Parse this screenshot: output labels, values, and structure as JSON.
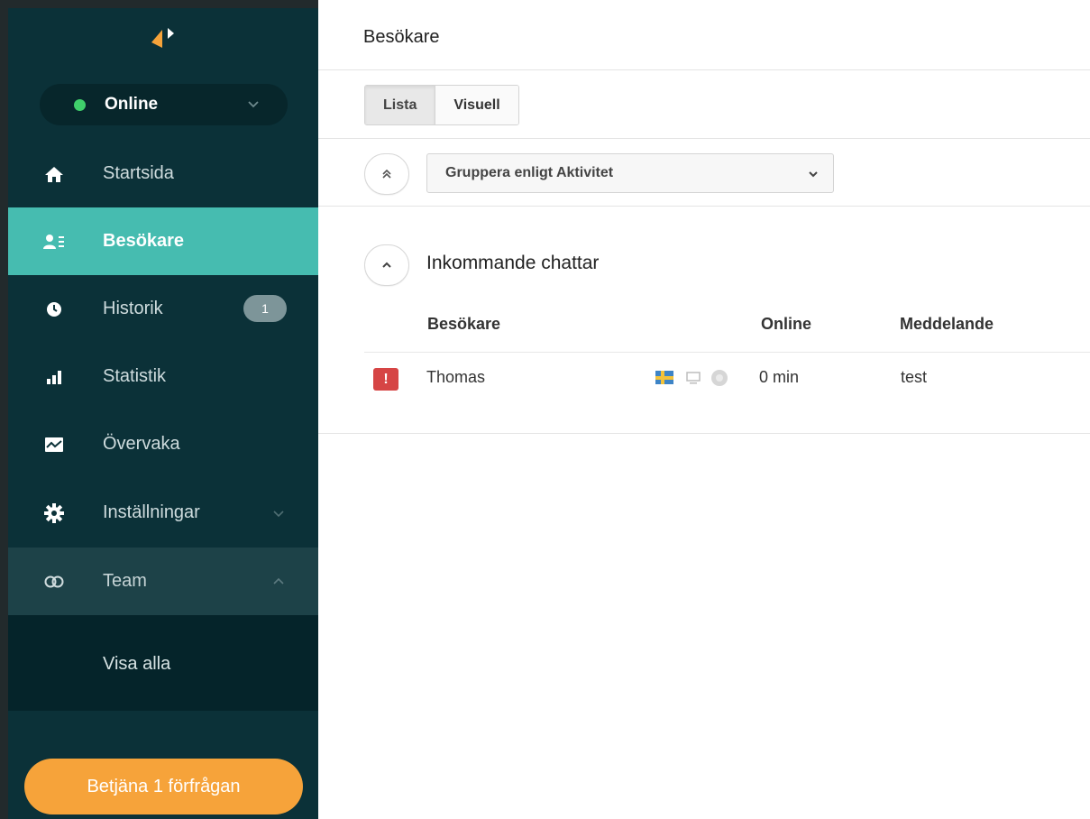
{
  "sidebar": {
    "status": {
      "label": "Online",
      "color": "#3fcf6b"
    },
    "nav": [
      {
        "label": "Startsida",
        "icon": "home-icon"
      },
      {
        "label": "Besökare",
        "icon": "visitors-icon",
        "active": true
      },
      {
        "label": "Historik",
        "icon": "clock-icon",
        "badge": "1"
      },
      {
        "label": "Statistik",
        "icon": "bar-chart-icon"
      },
      {
        "label": "Övervaka",
        "icon": "monitor-chart-icon"
      },
      {
        "label": "Inställningar",
        "icon": "gear-icon"
      },
      {
        "label": "Team",
        "icon": "team-rings-icon",
        "expanded": true
      }
    ],
    "team_sub": {
      "label": "Visa alla"
    },
    "serve_button": "Betjäna 1 förfrågan"
  },
  "main": {
    "title": "Besökare",
    "view_tabs": [
      {
        "label": "Lista",
        "active": true
      },
      {
        "label": "Visuell"
      }
    ],
    "group_select": {
      "label": "Gruppera enligt Aktivitet"
    },
    "section": {
      "title": "Inkommande chattar",
      "columns": [
        "Besökare",
        "Online",
        "Meddelande"
      ],
      "rows": [
        {
          "alert": "!",
          "visitor": "Thomas",
          "country_flag": "sweden-flag-icon",
          "device": "desktop-icon",
          "browser": "browser-icon",
          "online": "0 min",
          "message": "test"
        }
      ]
    }
  },
  "colors": {
    "sidebar_bg": "#0b3138",
    "active_item": "#46bcb0",
    "accent_orange": "#f6a33a",
    "alert_red": "#d64545"
  }
}
